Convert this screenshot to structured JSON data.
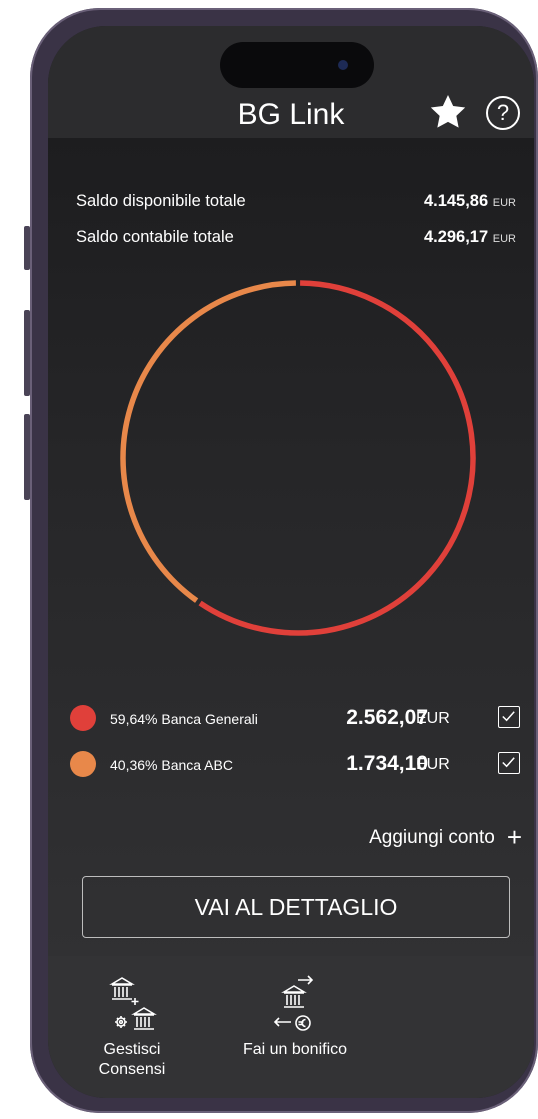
{
  "header": {
    "title": "BG Link",
    "favorite_icon": "star-icon",
    "help_icon": "question-circle-icon",
    "help_glyph": "?"
  },
  "balances": {
    "available_label": "Saldo disponibile totale",
    "available_value": "4.145,86",
    "available_currency": "EUR",
    "accounting_label": "Saldo contabile totale",
    "accounting_value": "4.296,17",
    "accounting_currency": "EUR"
  },
  "chart_data": {
    "type": "pie",
    "categories": [
      "Banca Generali",
      "Banca ABC"
    ],
    "values": [
      59.64,
      40.36
    ],
    "colors": [
      "#e0403a",
      "#e8884a"
    ],
    "style": "donut-ring"
  },
  "legend": [
    {
      "label": "59,64% Banca Generali",
      "amount": "2.562,07",
      "currency": "EUR",
      "color": "#e0403a",
      "checked": true
    },
    {
      "label": "40,36% Banca ABC",
      "amount": "1.734,10",
      "currency": "EUR",
      "color": "#e8884a",
      "checked": true
    }
  ],
  "actions": {
    "add_account_label": "Aggiungi conto",
    "add_account_icon": "plus-icon",
    "detail_button_label": "VAI AL DETTAGLIO"
  },
  "tabbar": {
    "tabs": [
      {
        "label_line1": "Gestisci",
        "label_line2": "Consensi",
        "icon": "bank-settings-icon"
      },
      {
        "label": "Fai un bonifico",
        "icon": "bank-transfer-euro-icon"
      }
    ]
  }
}
